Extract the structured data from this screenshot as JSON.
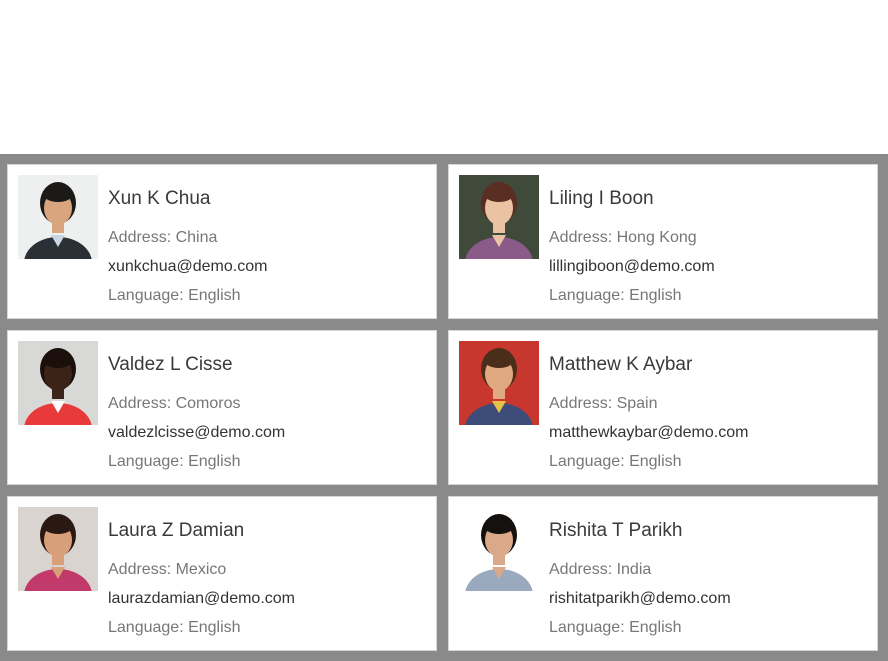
{
  "contacts": [
    {
      "name": "Xun K Chua",
      "address": "Address: China",
      "email": "xunkchua@demo.com",
      "language": "Language: English",
      "photo": {
        "bg": "#eef0f0",
        "skin": "#d9a57e",
        "hair": "#1c1a18",
        "shirt": "#2b2f36",
        "collar": "#c9d6e6"
      }
    },
    {
      "name": "Liling I Boon",
      "address": "Address: Hong Kong",
      "email": "lillingiboon@demo.com",
      "language": "Language: English",
      "photo": {
        "bg": "#3f4a3a",
        "skin": "#e9c3a4",
        "hair": "#5a2e22",
        "shirt": "#8a5a88",
        "collar": "#e9c3a4"
      }
    },
    {
      "name": "Valdez L Cisse",
      "address": "Address: Comoros",
      "email": "valdezlcisse@demo.com",
      "language": "Language: English",
      "photo": {
        "bg": "#d8d8d6",
        "skin": "#3b2318",
        "hair": "#1a0f0a",
        "shirt": "#e83a3a",
        "collar": "#ffffff"
      }
    },
    {
      "name": "Matthew K Aybar",
      "address": "Address: Spain",
      "email": "matthewkaybar@demo.com",
      "language": "Language: English",
      "photo": {
        "bg": "#c8372d",
        "skin": "#e0a982",
        "hair": "#4a2e1a",
        "shirt": "#3e4c7a",
        "collar": "#e6c24a"
      }
    },
    {
      "name": "Laura Z Damian",
      "address": "Address: Mexico",
      "email": "laurazdamian@demo.com",
      "language": "Language: English",
      "photo": {
        "bg": "#d9d4cf",
        "skin": "#d8a07a",
        "hair": "#2a1812",
        "shirt": "#c23a6a",
        "collar": "#d8a07a"
      }
    },
    {
      "name": "Rishita T Parikh",
      "address": "Address: India",
      "email": "rishitatparikh@demo.com",
      "language": "Language: English",
      "photo": {
        "bg": "#ffffff",
        "skin": "#d9a98a",
        "hair": "#15110f",
        "shirt": "#9aa9bd",
        "collar": "#d9a98a"
      }
    }
  ]
}
